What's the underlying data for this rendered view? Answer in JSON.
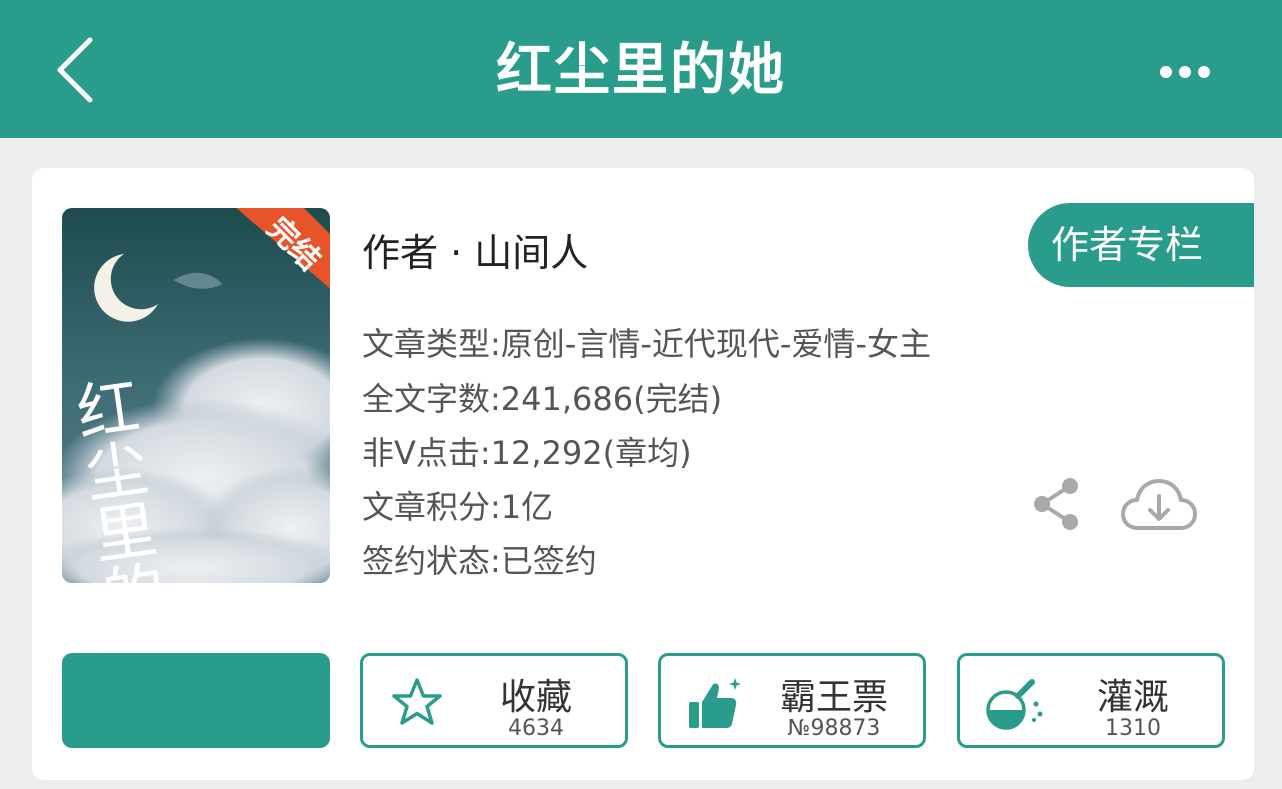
{
  "header": {
    "title": "红尘里的她",
    "back_icon": "chevron-left-icon",
    "more_icon": "more-horizontal-icon",
    "background_color": "#2a9c8c"
  },
  "book": {
    "cover": {
      "badge": "完结",
      "title_art": "红尘里的她"
    },
    "author_line": "作者 · 山间人",
    "author_column_button": "作者专栏",
    "info_lines": [
      "文章类型:原创-言情-近代现代-爱情-女主",
      "全文字数:241,686(完结)",
      "非V点击:12,292(章均)",
      "文章积分:1亿",
      "签约状态:已签约"
    ],
    "share_icon": "share-icon",
    "download_icon": "cloud-download-icon"
  },
  "actions": {
    "read_button_label": "",
    "collect": {
      "label": "收藏",
      "count": "4634",
      "icon": "star-icon"
    },
    "vote": {
      "label": "霸王票",
      "count": "№98873",
      "icon": "thumbs-up-icon"
    },
    "irrigate": {
      "label": "灌溉",
      "count": "1310",
      "icon": "flask-icon"
    }
  },
  "colors": {
    "accent": "#2a9c8c",
    "badge": "#e8542a",
    "icon_gray": "#a8a8a8"
  }
}
